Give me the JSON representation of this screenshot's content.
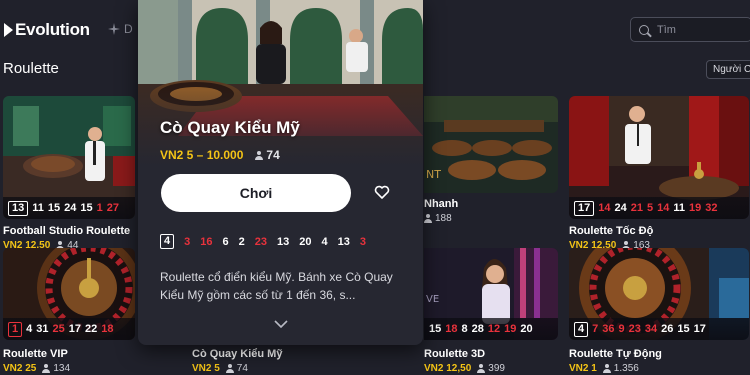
{
  "header": {
    "logo_text": "Evolution",
    "nav_fragment": "D",
    "search_placeholder": "Tìm"
  },
  "section": {
    "title": "Roulette",
    "sort_label": "Người C"
  },
  "cards": [
    {
      "title": "Football Studio Roulette",
      "bet": "VN2 12,50",
      "players": "44",
      "results": [
        {
          "n": "13",
          "red": false,
          "first": true
        },
        {
          "n": "11",
          "red": false
        },
        {
          "n": "15",
          "red": false
        },
        {
          "n": "24",
          "red": false
        },
        {
          "n": "15",
          "red": false
        },
        {
          "n": "1",
          "red": true
        },
        {
          "n": "27",
          "red": true
        }
      ]
    },
    {
      "title": "Nhanh",
      "bet": "",
      "players": "188",
      "results": []
    },
    {
      "title": "Roulette Tốc Độ",
      "bet": "VN2 12,50",
      "players": "163",
      "results": [
        {
          "n": "17",
          "red": false,
          "first": true
        },
        {
          "n": "14",
          "red": true
        },
        {
          "n": "24",
          "red": false
        },
        {
          "n": "21",
          "red": true
        },
        {
          "n": "5",
          "red": true
        },
        {
          "n": "14",
          "red": true
        },
        {
          "n": "11",
          "red": false
        },
        {
          "n": "19",
          "red": true
        },
        {
          "n": "32",
          "red": true
        }
      ]
    },
    {
      "title": "Roulette VIP",
      "bet": "VN2 25",
      "players": "134",
      "results": [
        {
          "n": "1",
          "red": true,
          "first": true
        },
        {
          "n": "4",
          "red": false
        },
        {
          "n": "31",
          "red": false
        },
        {
          "n": "25",
          "red": true
        },
        {
          "n": "17",
          "red": false
        },
        {
          "n": "22",
          "red": false
        },
        {
          "n": "18",
          "red": true
        }
      ]
    },
    {
      "title": "Cò Quay Kiểu Mỹ",
      "bet": "VN2 5",
      "players": "74",
      "results": []
    },
    {
      "title": "Roulette 3D",
      "bet": "VN2 12,50",
      "players": "399",
      "results": [
        {
          "n": "15",
          "red": false
        },
        {
          "n": "18",
          "red": true
        },
        {
          "n": "8",
          "red": false
        },
        {
          "n": "28",
          "red": false
        },
        {
          "n": "12",
          "red": true
        },
        {
          "n": "19",
          "red": true
        },
        {
          "n": "20",
          "red": false
        }
      ]
    },
    {
      "title": "Roulette Tự Động",
      "bet": "VN2 1",
      "players": "1.356",
      "results": [
        {
          "n": "4",
          "red": false,
          "first": true
        },
        {
          "n": "7",
          "red": true
        },
        {
          "n": "36",
          "red": true
        },
        {
          "n": "9",
          "red": true
        },
        {
          "n": "23",
          "red": true
        },
        {
          "n": "34",
          "red": true
        },
        {
          "n": "26",
          "red": false
        },
        {
          "n": "15",
          "red": false
        },
        {
          "n": "17",
          "red": false
        }
      ]
    }
  ],
  "popup": {
    "title": "Cò Quay Kiểu Mỹ",
    "bet_range": "VN2 5 – 10.000",
    "players": "74",
    "play_label": "Chơi",
    "results": [
      {
        "n": "4",
        "red": false,
        "first": true
      },
      {
        "n": "3",
        "red": true
      },
      {
        "n": "16",
        "red": true
      },
      {
        "n": "6",
        "red": false
      },
      {
        "n": "2",
        "red": false
      },
      {
        "n": "23",
        "red": true
      },
      {
        "n": "13",
        "red": false
      },
      {
        "n": "20",
        "red": false
      },
      {
        "n": "4",
        "red": false
      },
      {
        "n": "13",
        "red": false
      },
      {
        "n": "3",
        "red": true
      }
    ],
    "description": "Roulette cổ điển kiểu Mỹ. Bánh xe Cò Quay Kiểu Mỹ gồm các số từ 1 đến 36, s..."
  },
  "colors": {
    "accent_gold": "#f3c316",
    "red": "#e8323c",
    "bg": "#20212b"
  },
  "icons": [
    "evolution-logo-icon",
    "search-icon",
    "person-icon",
    "heart-icon",
    "chevron-down-icon"
  ]
}
